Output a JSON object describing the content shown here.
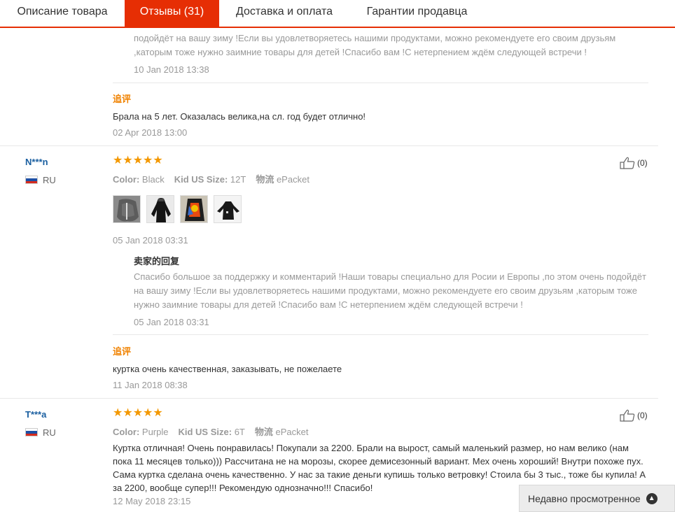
{
  "tabs": [
    {
      "label": "Описание товара"
    },
    {
      "label": "Отзывы (31)"
    },
    {
      "label": "Доставка и оплата"
    },
    {
      "label": "Гарантии продавца"
    }
  ],
  "top_reply": {
    "line2": "подойдёт на вашу зиму !Если вы удовлетворяетесь нашими продуктами, можно рекомендуете его своим друзьям",
    "line3": ",каторым тоже нужно заимние товары для детей !Спасибо вам !С нетерпением ждём следующей встречи !",
    "date": "10 Jan 2018 13:38"
  },
  "top_followup": {
    "label": "追评",
    "text": "Брала на 5 лет. Оказалась велика,на сл. год будет отлично!",
    "date": "02 Apr 2018 13:00"
  },
  "reviews": [
    {
      "user": "N***n",
      "country": "RU",
      "stars": "★★★★★",
      "color_label": "Color:",
      "color_value": "Black",
      "size_label": "Kid US Size:",
      "size_value": "12T",
      "ship_label": "物流",
      "ship_value": "ePacket",
      "likes": "(0)",
      "date": "05 Jan 2018 03:31",
      "seller_reply_title": "卖家的回复",
      "seller_reply": "Спасибо большое за поддержку и комментарий !Наши товары специально для Росии и Европы ,по этом очень подойдёт на вашу зиму !Если вы удовлетворяетесь нашими продуктами, можно рекомендуете его своим друзьям ,каторым тоже нужно заимние товары для детей !Спасибо вам !С нетерпением ждём следующей встречи !",
      "seller_reply_date": "05 Jan 2018 03:31",
      "followup_label": "追评",
      "followup_text": "куртка очень качественная, заказывать, не пожелаете",
      "followup_date": "11 Jan 2018 08:38"
    },
    {
      "user": "T***a",
      "country": "RU",
      "stars": "★★★★★",
      "color_label": "Color:",
      "color_value": "Purple",
      "size_label": "Kid US Size:",
      "size_value": "6T",
      "ship_label": "物流",
      "ship_value": "ePacket",
      "likes": "(0)",
      "text": "Куртка отличная! Очень понравилась! Покупали за 2200. Брали на вырост, самый маленький размер, но нам велико (нам пока 11 месяцев только))) Рассчитана не на морозы, скорее демисезонный вариант. Мех очень хороший! Внутри похоже пух. Сама куртка сделана очень качественно. У нас за такие деньги купишь только ветровку! Стоила бы 3 тыс., тоже бы купила! А за 2200, вообще супер!!! Рекомендую однозначно!!! Спасибо!",
      "date": "12 May 2018 23:15"
    }
  ],
  "recently_viewed": {
    "label": "Недавно просмотренное",
    "icon": "chevron-up-icon"
  },
  "colors": {
    "accent": "#e62e04",
    "star": "#f39800",
    "followup": "#f08200",
    "user": "#1a5fa0"
  }
}
